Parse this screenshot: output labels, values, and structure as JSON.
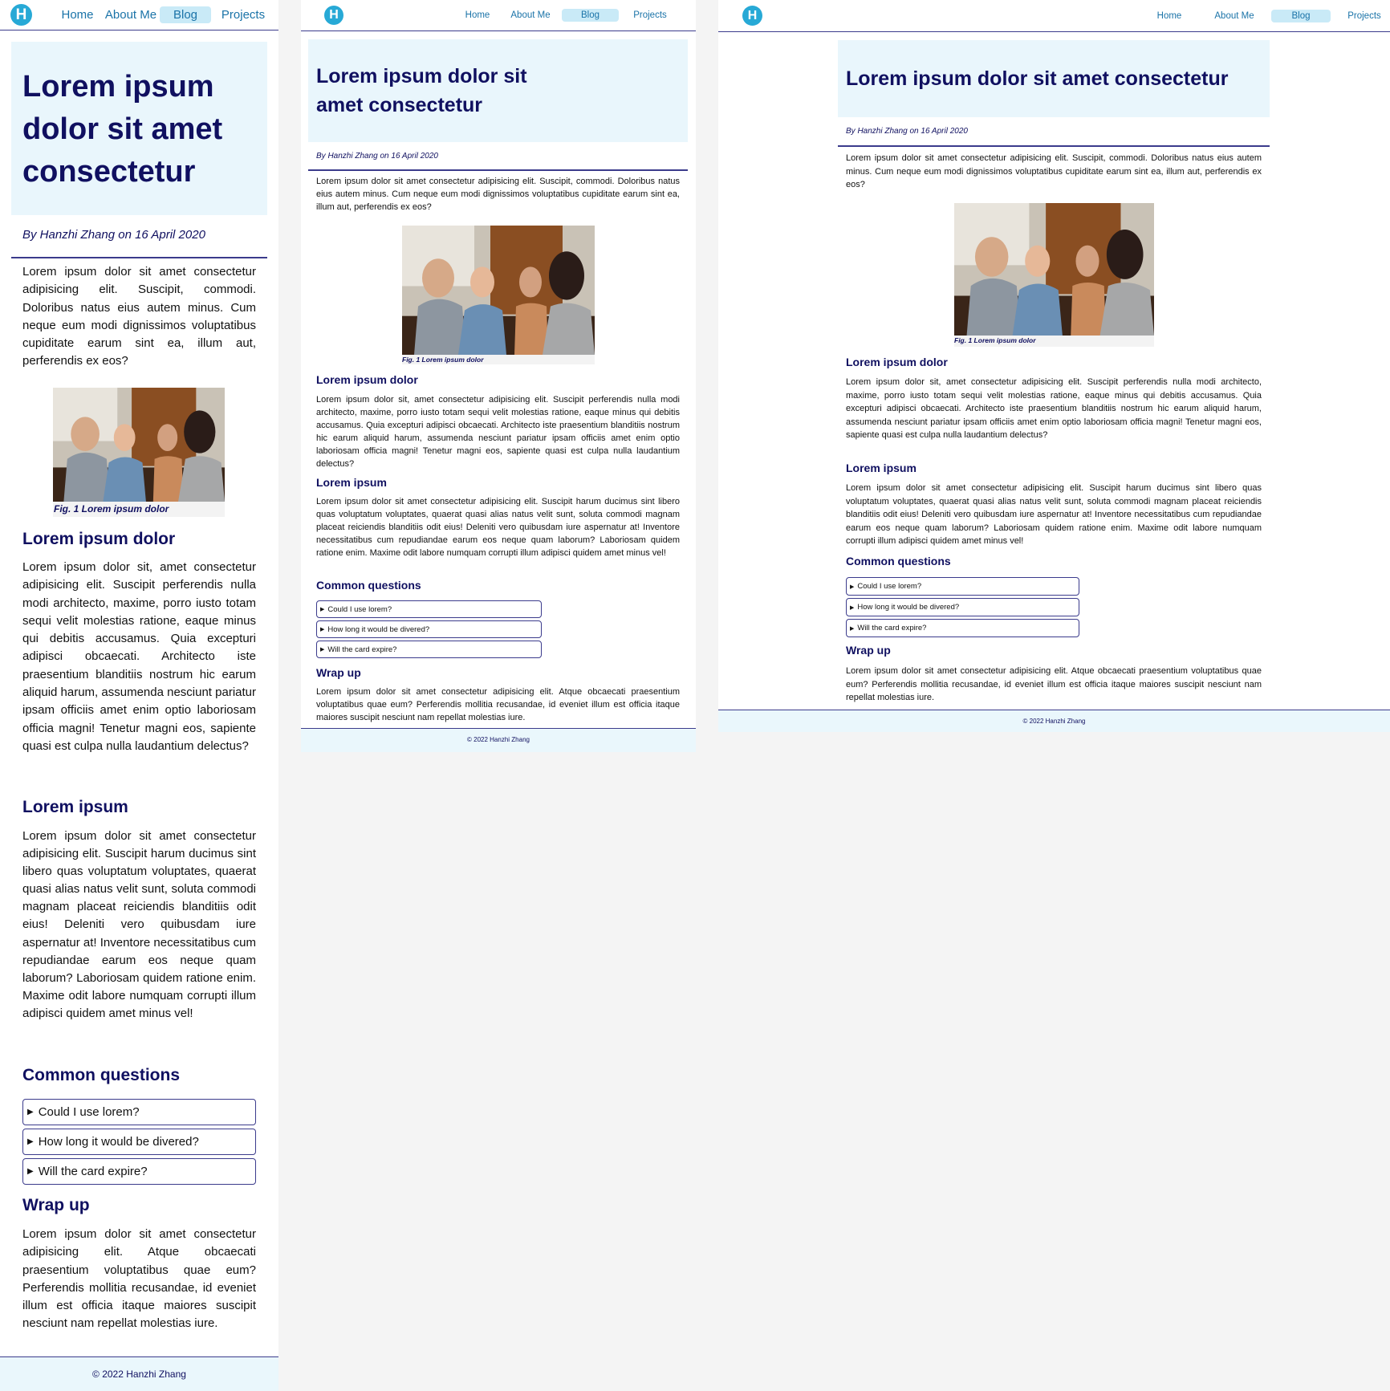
{
  "nav": {
    "logo_letter": "H",
    "links": [
      "Home",
      "About Me",
      "Blog",
      "Projects"
    ],
    "active": "Blog"
  },
  "article": {
    "title": "Lorem ipsum dolor sit amet consectetur",
    "byline": "By Hanzhi Zhang on 16 April 2020",
    "intro": "Lorem ipsum dolor sit amet consectetur adipisicing elit. Suscipit, commodi. Doloribus natus eius autem minus. Cum neque eum modi dignissimos voluptatibus cupiditate earum sint ea, illum aut, perferendis ex eos?",
    "figure_caption": "Fig. 1 Lorem ipsum dolor",
    "section1_heading": "Lorem ipsum dolor",
    "section1_text": "Lorem ipsum dolor sit, amet consectetur adipisicing elit. Suscipit perferendis nulla modi architecto, maxime, porro iusto totam sequi velit molestias ratione, eaque minus qui debitis accusamus. Quia excepturi adipisci obcaecati. Architecto iste praesentium blanditiis nostrum hic earum aliquid harum, assumenda nesciunt pariatur ipsam officiis amet enim optio laboriosam officia magni! Tenetur magni eos, sapiente quasi est culpa nulla laudantium delectus?",
    "section2_heading": "Lorem ipsum",
    "section2_text": "Lorem ipsum dolor sit amet consectetur adipisicing elit. Suscipit harum ducimus sint libero quas voluptatum voluptates, quaerat quasi alias natus velit sunt, soluta commodi magnam placeat reiciendis blanditiis odit eius! Deleniti vero quibusdam iure aspernatur at! Inventore necessitatibus cum repudiandae earum eos neque quam laborum? Laboriosam quidem ratione enim. Maxime odit labore numquam corrupti illum adipisci quidem amet minus vel!",
    "faq_heading": "Common questions",
    "faq": [
      "Could I use lorem?",
      "How long it would be divered?",
      "Will the card expire?"
    ],
    "wrap_heading": "Wrap up",
    "wrap_text": "Lorem ipsum dolor sit amet consectetur adipisicing elit. Atque obcaecati praesentium voluptatibus quae eum? Perferendis mollitia recusandae, id eveniet illum est officia itaque maiores suscipit nesciunt nam repellat molestias iure."
  },
  "footer": {
    "text": "© 2022 Hanzhi Zhang"
  },
  "colors": {
    "navy": "#101060",
    "accent": "#27a9d6",
    "hero_bg": "#e9f6fc",
    "active_bg": "#c9eaf7"
  }
}
